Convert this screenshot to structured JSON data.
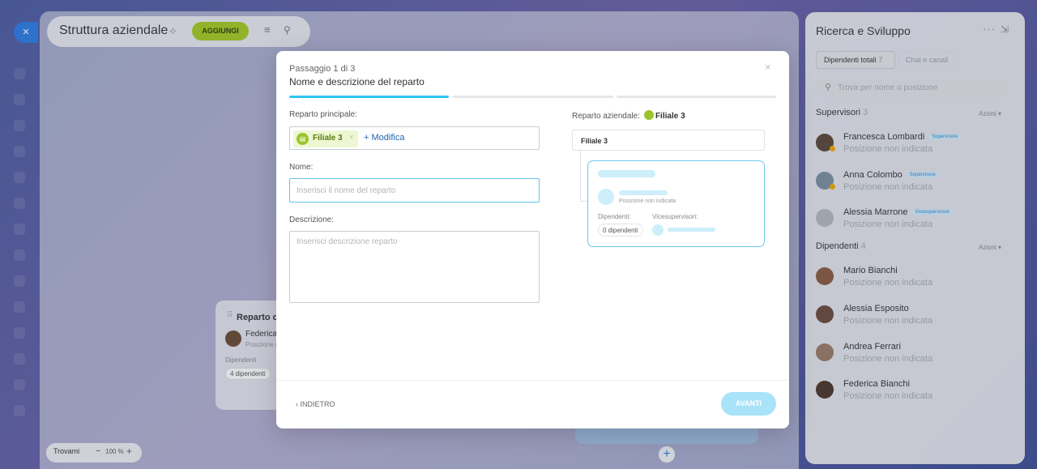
{
  "app": {
    "title": "Struttura aziendale",
    "add_label": "AGGIUNGI",
    "close_icon": "×",
    "pin_icon": "✧",
    "menu_icon": "≡",
    "search_icon": "⚲"
  },
  "canvas": {
    "dept_card": {
      "title": "Reparto co",
      "person_name": "Federica",
      "person_position": "Posizione n",
      "employees_label": "Dipendenti",
      "employees_count": "4 dipendenti"
    },
    "add_icon": "+",
    "zoom": {
      "find_label": "Trovami",
      "minus": "−",
      "value": "100 %",
      "plus": "+"
    }
  },
  "side_panel": {
    "title": "Ricerca e Sviluppo",
    "more_icon": "···",
    "collapse_icon": "⇲",
    "tabs": [
      {
        "label": "Dipendenti totali",
        "count": "7"
      },
      {
        "label": "Chat e canali"
      }
    ],
    "search_placeholder": "Trova per nome o posizione",
    "supervisors": {
      "title": "Supervisori",
      "count": "3",
      "action": "Azioni",
      "people": [
        {
          "name": "Francesca Lombardi",
          "badge": "Supervisore",
          "position": "Posizione non indicata"
        },
        {
          "name": "Anna Colombo",
          "badge": "Supervisore",
          "position": "Posizione non indicata"
        },
        {
          "name": "Alessia Marrone",
          "badge": "Vicesupervisore",
          "position": "Posizione non indicata"
        }
      ]
    },
    "employees": {
      "title": "Dipendenti",
      "count": "4",
      "action": "Azioni",
      "people": [
        {
          "name": "Mario Bianchi",
          "position": "Posizione non indicata"
        },
        {
          "name": "Alessia Esposito",
          "position": "Posizione non indicata"
        },
        {
          "name": "Andrea Ferrari",
          "position": "Posizione non indicata"
        },
        {
          "name": "Federica Bianchi",
          "position": "Posizione non indicata"
        }
      ]
    }
  },
  "modal": {
    "step": "Passaggio 1 di 3",
    "title": "Nome e descrizione del reparto",
    "close_icon": "×",
    "progress_step": 1,
    "parent_label": "Reparto principale:",
    "parent_chip": "Filiale 3",
    "parent_chip_remove": "×",
    "modify_label": "+ Modifica",
    "name_label": "Nome:",
    "name_placeholder": "Inserisci il nome del reparto",
    "description_label": "Descrizione:",
    "description_placeholder": "Inserisci descrizione reparto",
    "company_label": "Reparto aziendale:",
    "company_name": "Filiale 3",
    "tree_root": "Filiale 3",
    "preview": {
      "position": "Posizione non indicata",
      "employees_label": "Dipendenti:",
      "vice_label": "Vicesupervisori:",
      "employees_count": "0 dipendenti"
    },
    "back_label": "‹ INDIETRO",
    "next_label": "AVANTI"
  },
  "colors": {
    "accent": "#2fc6f6",
    "green": "#a5cb1f",
    "link": "#2067b0"
  }
}
